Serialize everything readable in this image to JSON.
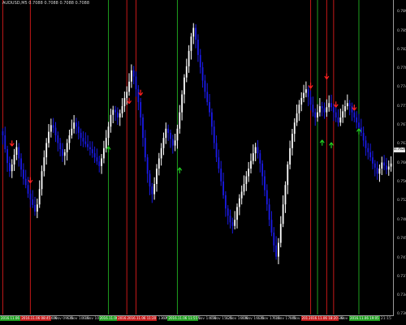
{
  "header": {
    "text": "AUDUSD,M5 0.7088 0.7088 0.7088 0.7088"
  },
  "current_price": "0.7626",
  "price_axis": [
    "0.7895",
    "0.7858",
    "0.7821",
    "0.7785",
    "0.7748",
    "0.7711",
    "0.7674",
    "0.7637",
    "0.7600",
    "0.7563",
    "0.7526",
    "0.7489",
    "0.7452",
    "0.7415",
    "0.7378",
    "0.7341",
    "0.7305"
  ],
  "time_axis": [
    "6 Nov 08:40",
    "6 Nov 08:45",
    "6 Nov 09:00",
    "6 Nov 09:35",
    "6 Nov 10:10",
    "6 Nov 10:45",
    "6 Nov 11:20",
    "6 Nov 11:55",
    "6 Nov 12:30",
    "6 Nov 13:05",
    "6 Nov 13:40",
    "6 Nov 14:15",
    "6 Nov 14:50",
    "6 Nov 15:25",
    "6 Nov 16:00",
    "6 Nov 16:35",
    "6 Nov 17:10",
    "6 Nov 17:45",
    "6 Nov 18:20",
    "6 Nov 18:55",
    "6 Nov 19:30",
    "6 Nov 20:05",
    "6 Nov 20:40",
    "6 Nov 21:15"
  ],
  "time_badges": [
    {
      "label": "2016.11.06 08:40",
      "color": "#1e9e1e"
    },
    {
      "label": "2016.11.06 08:45",
      "color": "#c41818"
    },
    {
      "label": "2016.11.06 09:35",
      "color": "#1e9e1e"
    },
    {
      "label": "2016.11.06 10:10",
      "color": "#c41818"
    },
    {
      "label": "2016.11.06 11:20",
      "color": "#c41818"
    },
    {
      "label": "2016.11.06 11:55",
      "color": "#1e9e1e"
    },
    {
      "label": "2016.11.06 18:00",
      "color": "#c41818"
    },
    {
      "label": "2016.11.06 18:20",
      "color": "#c41818"
    },
    {
      "label": "2016.11.06 19:05",
      "color": "#1e9e1e"
    }
  ],
  "colors": {
    "bull": "#ffffff",
    "bear": "#1a1ae6",
    "buy_signal": "#22cc22",
    "sell_signal": "#ff2020",
    "buy_line": "#1e9e1e",
    "sell_line": "#c41818"
  },
  "chart_data": {
    "type": "candlestick",
    "symbol": "AUDUSD",
    "timeframe": "M5",
    "ylim": [
      0.7305,
      0.791
    ],
    "signal_lines": [
      {
        "type": "sell",
        "x_index": 0
      },
      {
        "type": "sell",
        "x_index": 12
      },
      {
        "type": "buy",
        "x_index": 46
      },
      {
        "type": "sell",
        "x_index": 54
      },
      {
        "type": "sell",
        "x_index": 58
      },
      {
        "type": "buy",
        "x_index": 76
      },
      {
        "type": "sell",
        "x_index": 134
      },
      {
        "type": "buy",
        "x_index": 137
      },
      {
        "type": "sell",
        "x_index": 141
      },
      {
        "type": "sell",
        "x_index": 144
      },
      {
        "type": "buy",
        "x_index": 155
      }
    ],
    "arrows": [
      {
        "type": "sell",
        "x_index": 4,
        "price": 0.7642
      },
      {
        "type": "sell",
        "x_index": 12,
        "price": 0.757
      },
      {
        "type": "buy",
        "x_index": 46,
        "price": 0.7625
      },
      {
        "type": "sell",
        "x_index": 55,
        "price": 0.7725
      },
      {
        "type": "sell",
        "x_index": 60,
        "price": 0.7741
      },
      {
        "type": "buy",
        "x_index": 77,
        "price": 0.7584
      },
      {
        "type": "sell",
        "x_index": 134,
        "price": 0.7755
      },
      {
        "type": "sell",
        "x_index": 141,
        "price": 0.7773
      },
      {
        "type": "buy",
        "x_index": 139,
        "price": 0.7638
      },
      {
        "type": "buy",
        "x_index": 143,
        "price": 0.7633
      },
      {
        "type": "sell",
        "x_index": 145,
        "price": 0.7718
      },
      {
        "type": "sell",
        "x_index": 153,
        "price": 0.7712
      },
      {
        "type": "buy",
        "x_index": 155,
        "price": 0.766
      }
    ],
    "close": [
      0.7655,
      0.7628,
      0.7601,
      0.7585,
      0.7598,
      0.7617,
      0.7632,
      0.761,
      0.7588,
      0.757,
      0.7558,
      0.7541,
      0.753,
      0.7519,
      0.7506,
      0.752,
      0.755,
      0.7585,
      0.7612,
      0.764,
      0.7662,
      0.7675,
      0.767,
      0.7655,
      0.764,
      0.7628,
      0.7615,
      0.7622,
      0.764,
      0.7655,
      0.7668,
      0.768,
      0.7672,
      0.766,
      0.765,
      0.7643,
      0.7638,
      0.7632,
      0.7628,
      0.762,
      0.7612,
      0.7604,
      0.7595,
      0.761,
      0.763,
      0.765,
      0.7672,
      0.7695,
      0.7705,
      0.77,
      0.769,
      0.7698,
      0.7712,
      0.7728,
      0.774,
      0.776,
      0.7782,
      0.777,
      0.7745,
      0.772,
      0.769,
      0.765,
      0.7612,
      0.758,
      0.7555,
      0.754,
      0.756,
      0.759,
      0.761,
      0.763,
      0.765,
      0.7668,
      0.766,
      0.7648,
      0.7635,
      0.7645,
      0.7668,
      0.77,
      0.7735,
      0.7768,
      0.779,
      0.782,
      0.7848,
      0.7865,
      0.7842,
      0.7812,
      0.7788,
      0.7762,
      0.774,
      0.772,
      0.77,
      0.7672,
      0.764,
      0.7612,
      0.759,
      0.7565,
      0.7538,
      0.7512,
      0.7498,
      0.7485,
      0.7478,
      0.749,
      0.7515,
      0.7532,
      0.7545,
      0.756,
      0.7575,
      0.759,
      0.7605,
      0.762,
      0.7632,
      0.762,
      0.76,
      0.7575,
      0.7548,
      0.752,
      0.749,
      0.7465,
      0.744,
      0.7418,
      0.7445,
      0.7482,
      0.752,
      0.7558,
      0.7598,
      0.763,
      0.7658,
      0.768,
      0.7698,
      0.7715,
      0.7728,
      0.7738,
      0.7745,
      0.773,
      0.7715,
      0.77,
      0.769,
      0.77,
      0.7712,
      0.7708,
      0.77,
      0.771,
      0.7718,
      0.771,
      0.77,
      0.769,
      0.768,
      0.769,
      0.7702,
      0.7712,
      0.7718,
      0.7712,
      0.77,
      0.769,
      0.768,
      0.767,
      0.766,
      0.7645,
      0.763,
      0.7622,
      0.7612,
      0.76,
      0.7592,
      0.758,
      0.759,
      0.7602,
      0.7596,
      0.7588,
      0.7594,
      0.76
    ]
  }
}
